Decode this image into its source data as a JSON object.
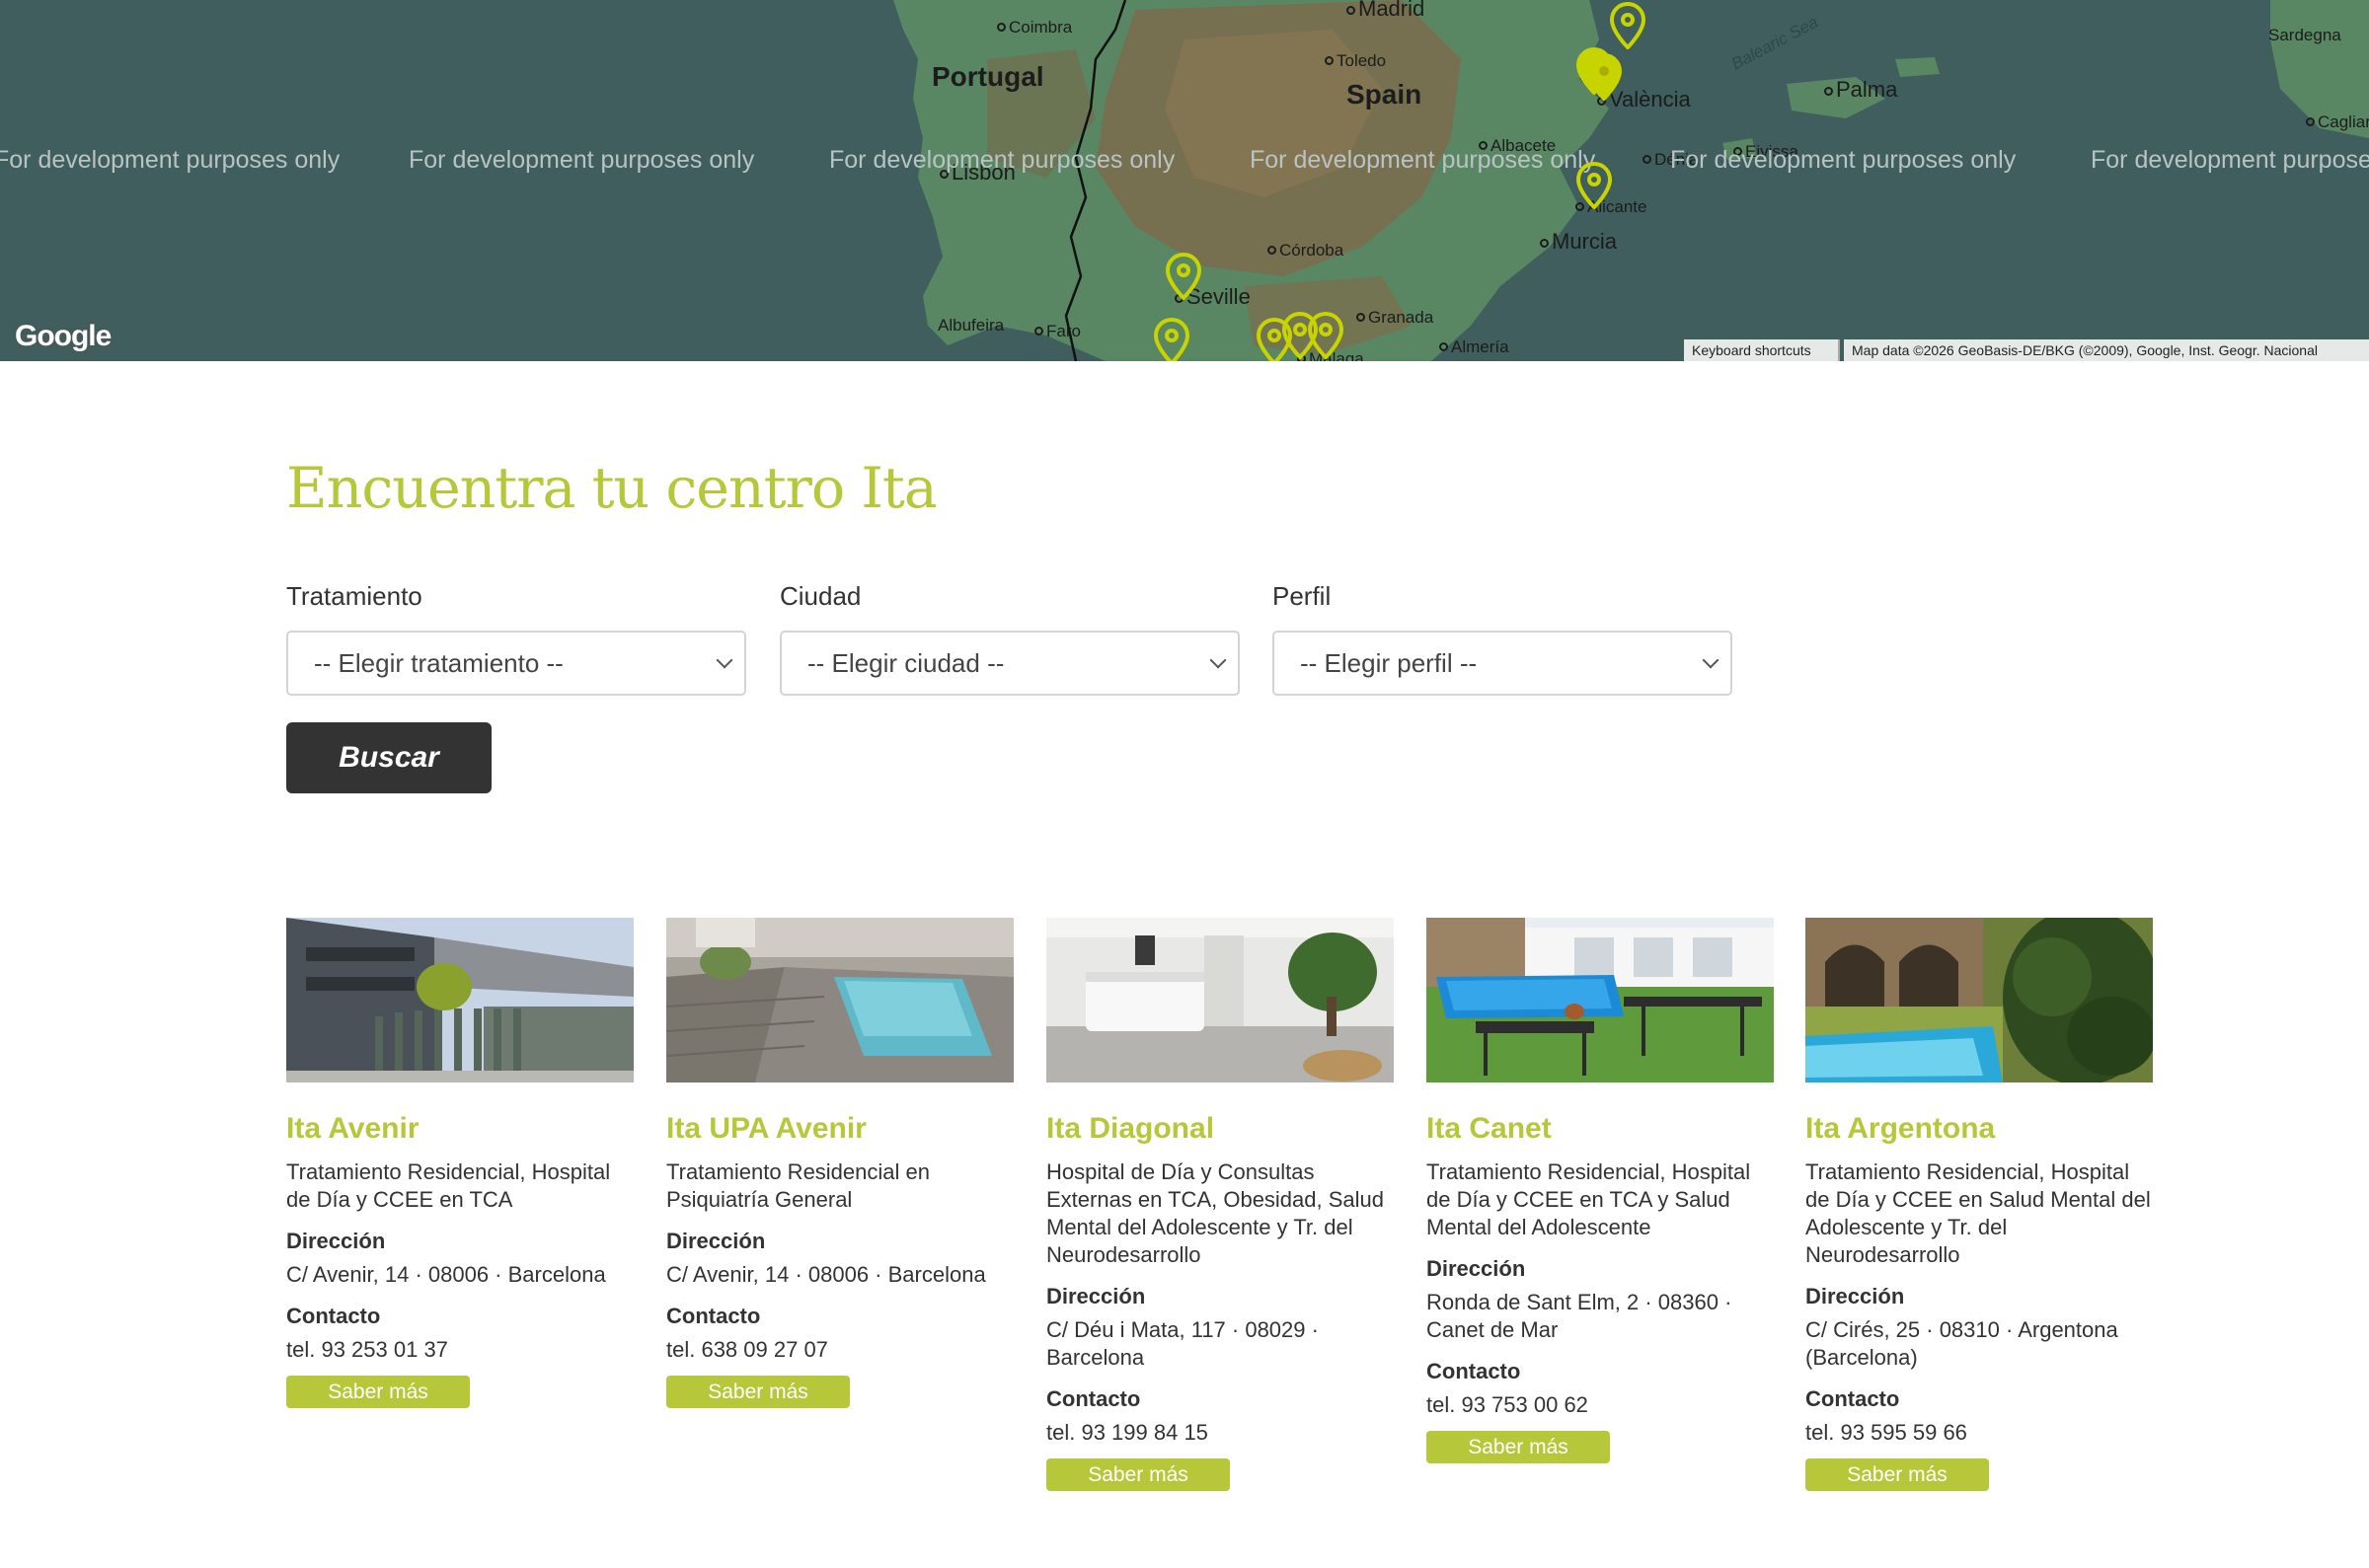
{
  "map": {
    "dev_watermark": "For development purposes only",
    "countries": {
      "portugal": "Portugal",
      "spain": "Spain"
    },
    "cities": {
      "madrid": "Madrid",
      "coimbra": "Coimbra",
      "toledo": "Toledo",
      "valencia": "València",
      "palma": "Palma",
      "lisbon": "Lisbon",
      "albacete": "Albacete",
      "denia": "Dénia",
      "eivissa": "Eivissa",
      "alicante": "Alicante",
      "murcia": "Murcia",
      "cordoba": "Córdoba",
      "seville": "Seville",
      "granada": "Granada",
      "albufeira": "Albufeira",
      "faro": "Faro",
      "malaga": "Málaga",
      "almeria": "Almería",
      "sardegna": "Sardegna",
      "cagliari": "Cagliari"
    },
    "water": {
      "balearic_sea": "Balearic Sea"
    },
    "google_logo": "Google",
    "keyboard_shortcuts": "Keyboard shortcuts",
    "map_data": "Map data ©2026 GeoBasis-DE/BKG (©2009), Google, Inst. Geogr. Nacional",
    "pin_color": "#c8d400"
  },
  "finder": {
    "title": "Encuentra tu centro Ita",
    "filters": [
      {
        "label": "Tratamiento",
        "value": "-- Elegir tratamiento --"
      },
      {
        "label": "Ciudad",
        "value": "-- Elegir ciudad --"
      },
      {
        "label": "Perfil",
        "value": "-- Elegir perfil --"
      }
    ],
    "search_button": "Buscar"
  },
  "centers": [
    {
      "name": "Ita Avenir",
      "description": "Tratamiento Residencial, Hospital de Día y CCEE en TCA",
      "address_label": "Dirección",
      "address": "C/ Avenir, 14 · 08006 · Barcelona",
      "contact_label": "Contacto",
      "phone": "tel. 93 253 01 37",
      "button": "Saber más"
    },
    {
      "name": "Ita UPA Avenir",
      "description": "Tratamiento Residencial en Psiquiatría General",
      "address_label": "Dirección",
      "address": "C/ Avenir, 14 · 08006 · Barcelona",
      "contact_label": "Contacto",
      "phone": "tel. 638 09 27 07",
      "button": "Saber más"
    },
    {
      "name": "Ita Diagonal",
      "description": "Hospital de Día y Consultas Externas en TCA, Obesidad, Salud Mental del Adolescente y Tr. del Neurodesarrollo",
      "address_label": "Dirección",
      "address": "C/ Déu i Mata, 117 · 08029 · Barcelona",
      "contact_label": "Contacto",
      "phone": "tel. 93 199 84 15",
      "button": "Saber más"
    },
    {
      "name": "Ita Canet",
      "description": "Tratamiento Residencial, Hospital de Día y CCEE en TCA y Salud Mental del Adolescente",
      "address_label": "Dirección",
      "address": "Ronda de Sant Elm, 2 · 08360 · Canet de Mar",
      "contact_label": "Contacto",
      "phone": "tel. 93 753 00 62",
      "button": "Saber más"
    },
    {
      "name": "Ita Argentona",
      "description": "Tratamiento Residencial, Hospital de Día y CCEE en Salud Mental del Adolescente y Tr. del Neurodesarrollo",
      "address_label": "Dirección",
      "address": "C/ Cirés, 25 · 08310 · Argentona (Barcelona)",
      "contact_label": "Contacto",
      "phone": "tel. 93 595 59 66",
      "button": "Saber más"
    }
  ]
}
